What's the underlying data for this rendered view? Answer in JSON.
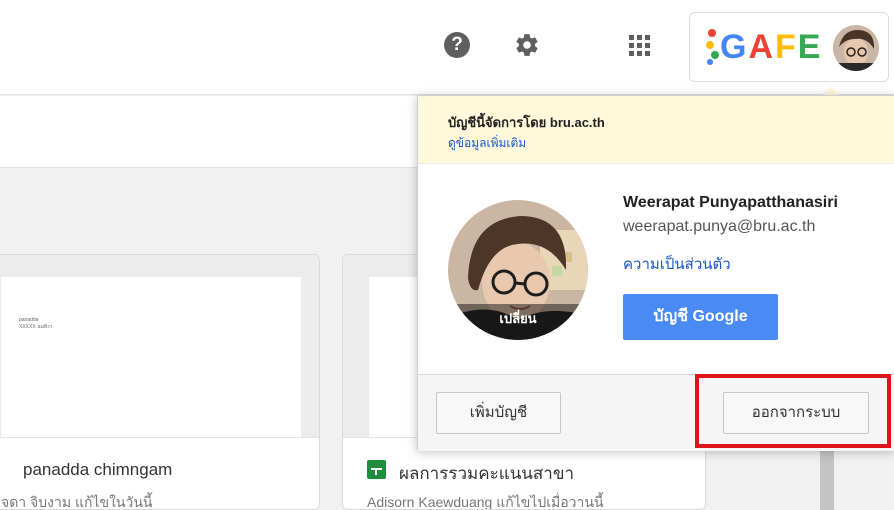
{
  "header": {
    "help_icon": "help-icon",
    "settings_icon": "gear-icon",
    "apps_icon": "apps-grid-icon",
    "brand_text": "GAFE",
    "brand_colors": [
      "#4285f4",
      "#ea4335",
      "#fbbc05",
      "#34a853"
    ]
  },
  "background_files": [
    {
      "title": "panadda chimngam",
      "subtitle": "จดา จิบงาม แก้ไขในวันนี้",
      "thumb_lines": [
        "panadda",
        "XXXXX นนทิงา"
      ]
    },
    {
      "title": "ผลการรวมคะแนนสาขา",
      "subtitle": "Adisorn Kaewduang แก้ไขไปเมื่อวานนี้",
      "icon": "sheets-icon"
    }
  ],
  "account_popup": {
    "managed_notice": "บัญชีนี้จัดการโดย bru.ac.th",
    "learn_more": "ดูข้อมูลเพิ่มเติม",
    "change_photo": "เปลี่ยน",
    "name": "Weerapat Punyapatthanasiri",
    "email": "weerapat.punya@bru.ac.th",
    "privacy_link": "ความเป็นส่วนตัว",
    "google_account_button": "บัญชี Google",
    "add_account_button": "เพิ่มบัญชี",
    "sign_out_button": "ออกจากระบบ"
  },
  "colors": {
    "accent_blue": "#4a8af4",
    "link_blue": "#1a56c6",
    "banner_yellow": "#fff9dc",
    "highlight_red": "#e0141e"
  }
}
